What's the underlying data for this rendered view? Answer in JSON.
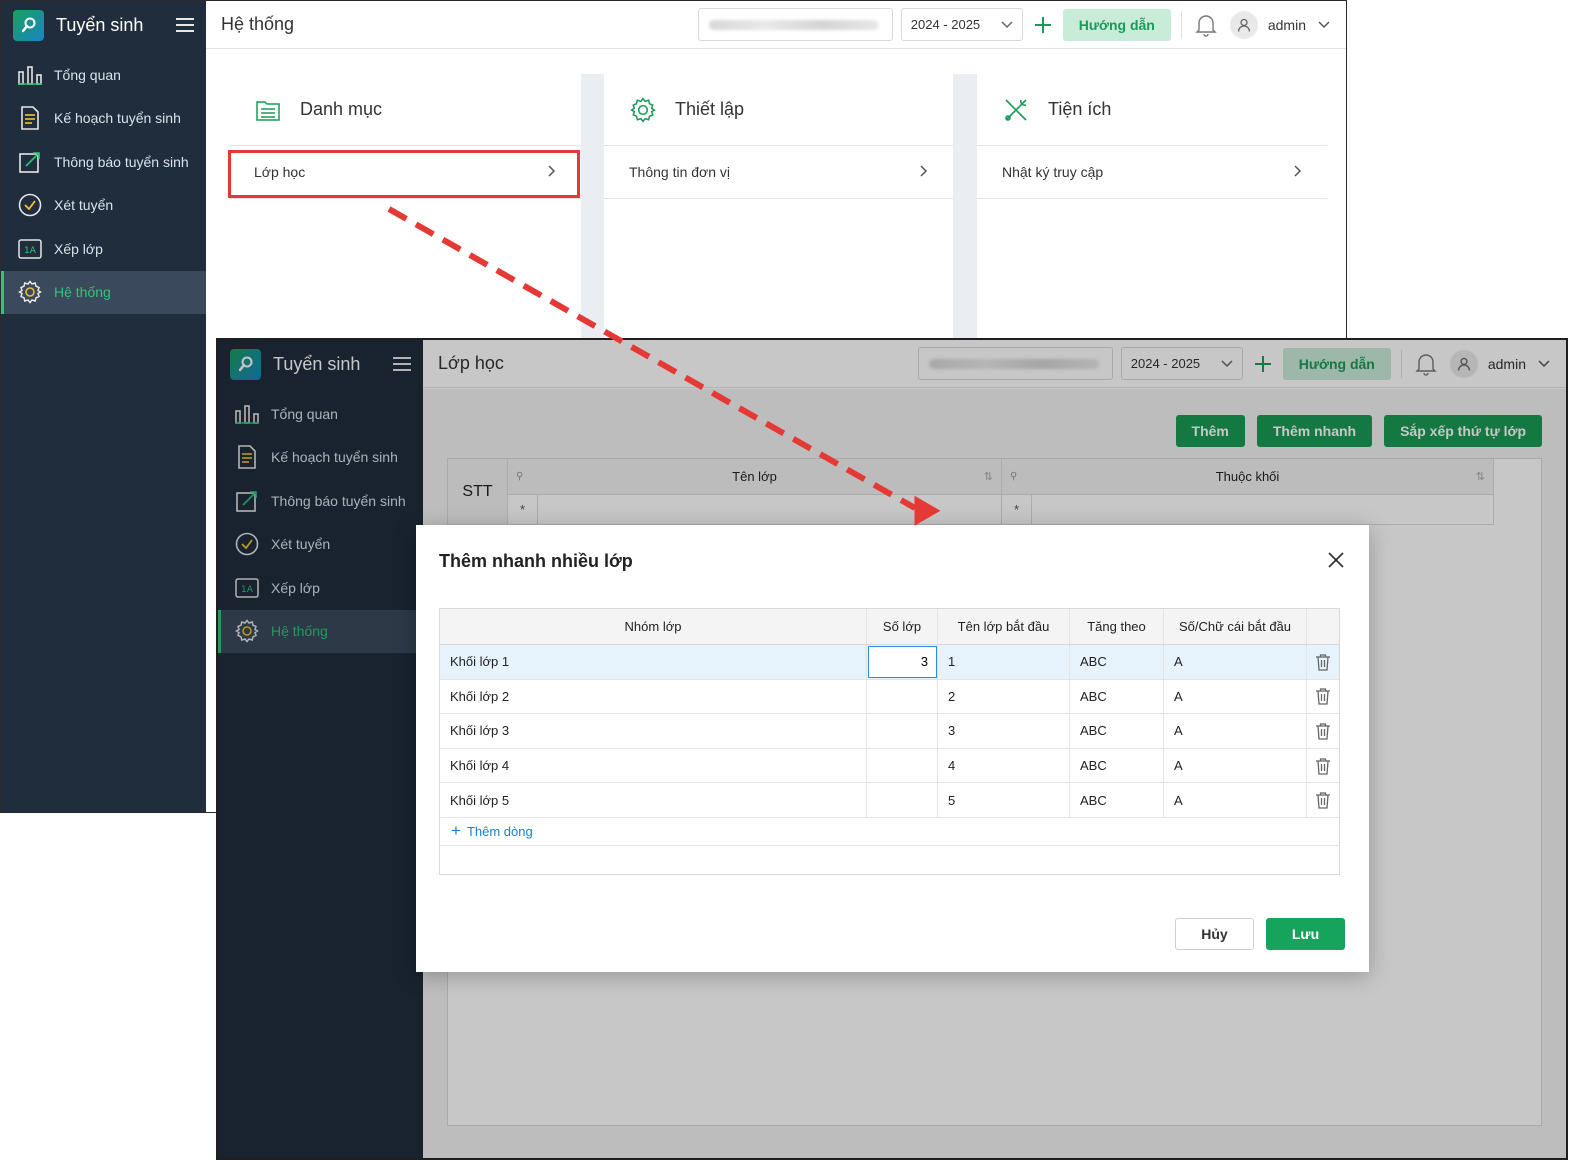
{
  "app": {
    "name": "Tuyển sinh",
    "user": "admin"
  },
  "nav": [
    {
      "label": "Tổng quan",
      "icon": "bar-chart-icon"
    },
    {
      "label": "Kế hoạch tuyển sinh",
      "icon": "document-icon"
    },
    {
      "label": "Thông báo tuyển sinh",
      "icon": "announcement-icon"
    },
    {
      "label": "Xét tuyển",
      "icon": "check-circle-icon"
    },
    {
      "label": "Xếp lớp",
      "icon": "class-1a-icon",
      "icon_text": "1A"
    },
    {
      "label": "Hệ thống",
      "icon": "gear-icon",
      "active": true
    }
  ],
  "topbar": {
    "year": "2024 - 2025",
    "guide_label": "Hướng dẫn"
  },
  "window1": {
    "title": "Hệ thống",
    "columns": [
      {
        "heading": "Danh mục",
        "icon": "list-icon",
        "item": "Lớp học"
      },
      {
        "heading": "Thiết lập",
        "icon": "gear-icon",
        "item": "Thông tin đơn vị"
      },
      {
        "heading": "Tiện ích",
        "icon": "tools-icon",
        "item": "Nhật ký truy cập"
      }
    ]
  },
  "window2": {
    "title": "Lớp học",
    "actions": {
      "add": "Thêm",
      "quick_add": "Thêm nhanh",
      "sort": "Sắp xếp thứ tự lớp"
    },
    "grid": {
      "stt": "STT",
      "col_name": "Tên lớp",
      "col_khoi": "Thuộc khối",
      "filter_symbol": "*"
    }
  },
  "modal": {
    "title": "Thêm nhanh nhiều lớp",
    "headers": [
      "Nhóm lớp",
      "Số lớp",
      "Tên lớp bắt đầu",
      "Tăng theo",
      "Số/Chữ cái bắt đầu"
    ],
    "rows": [
      {
        "group": "Khối lớp 1",
        "count": "3",
        "start": "1",
        "increment": "ABC",
        "letter": "A"
      },
      {
        "group": "Khối lớp 2",
        "count": "",
        "start": "2",
        "increment": "ABC",
        "letter": "A"
      },
      {
        "group": "Khối lớp 3",
        "count": "",
        "start": "3",
        "increment": "ABC",
        "letter": "A"
      },
      {
        "group": "Khối lớp 4",
        "count": "",
        "start": "4",
        "increment": "ABC",
        "letter": "A"
      },
      {
        "group": "Khối lớp 5",
        "count": "",
        "start": "5",
        "increment": "ABC",
        "letter": "A"
      }
    ],
    "add_row": "Thêm dòng",
    "cancel": "Hủy",
    "save": "Lưu"
  },
  "colors": {
    "sidebar": "#1f2d3d",
    "accent": "#1a9a55",
    "highlight": "#e53935",
    "arrow": "#e53935"
  }
}
